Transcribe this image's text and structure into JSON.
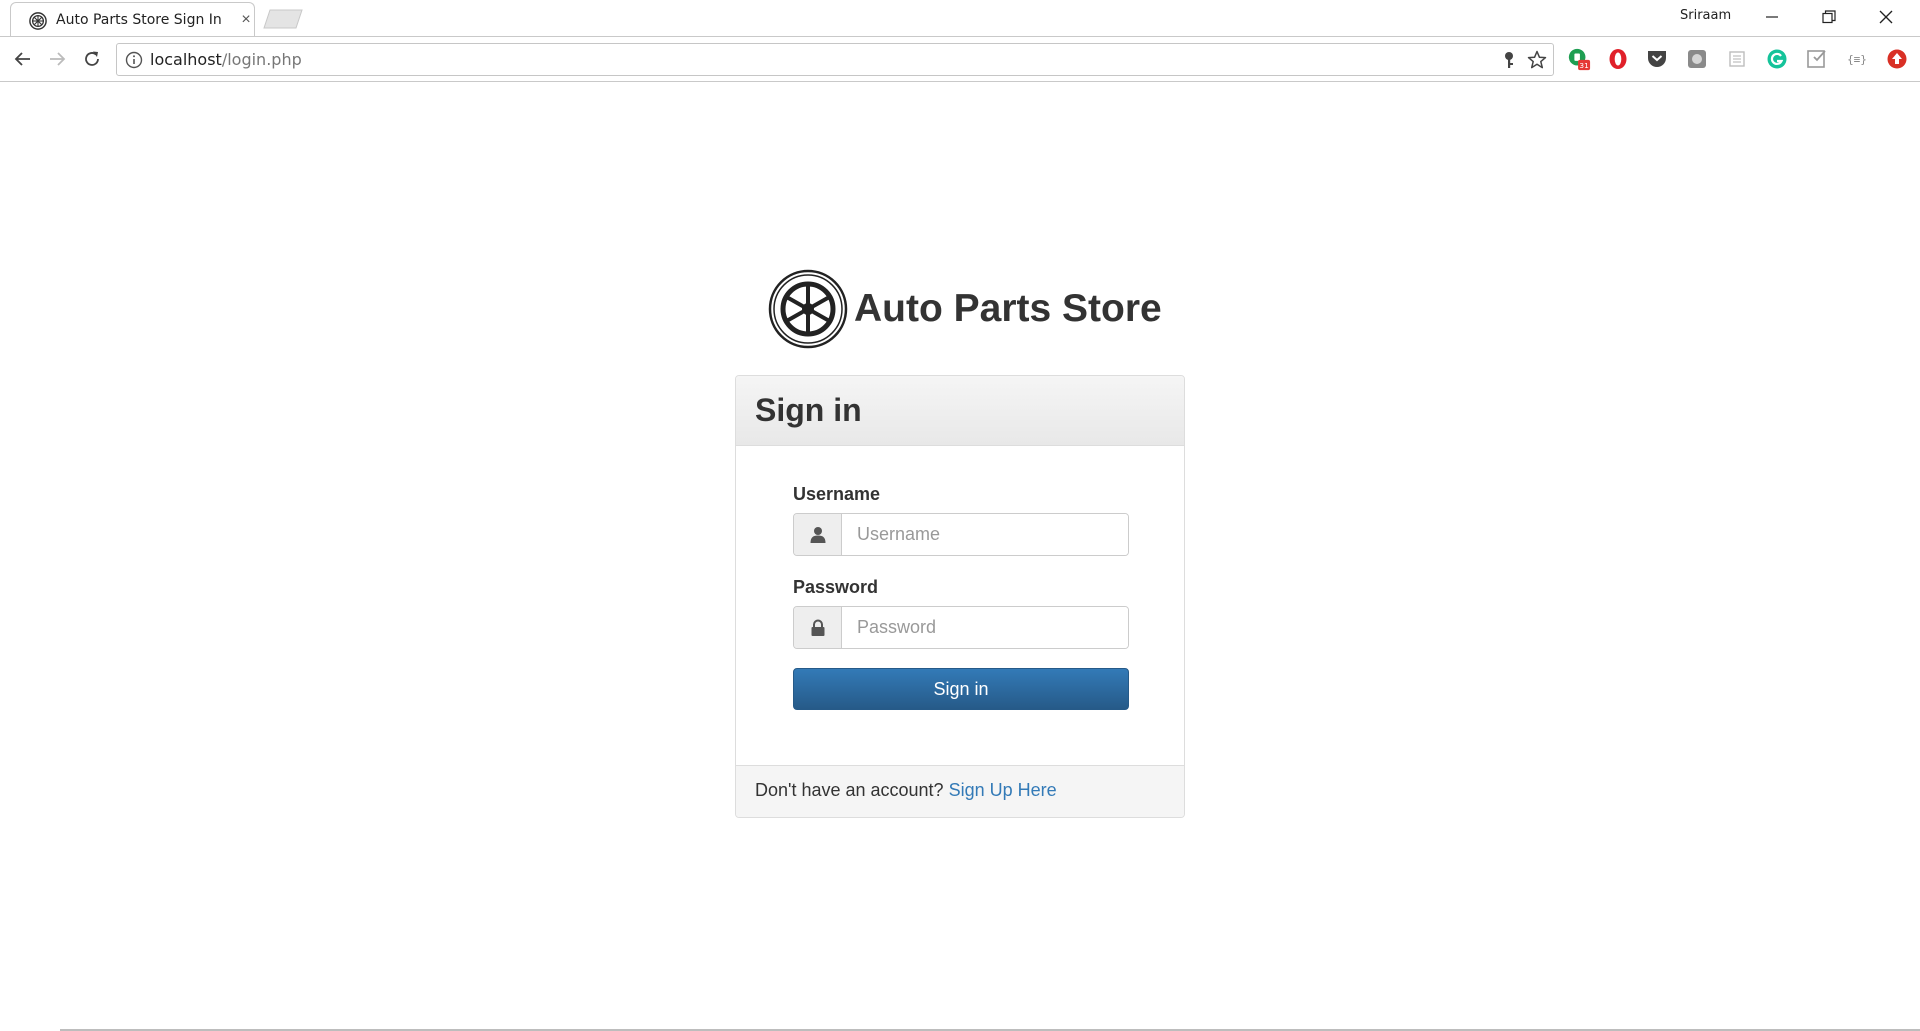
{
  "browser": {
    "tab": {
      "title": "Auto Parts Store Sign In",
      "close_icon": "×",
      "favicon_icon": "wheel-icon"
    },
    "user_name": "Sriraam",
    "address_bar": {
      "host": "localhost",
      "path": "/login.php"
    },
    "extensions": [
      {
        "name": "calendar-extension-icon",
        "badge": "31",
        "color": "#1e9e52"
      },
      {
        "name": "opera-extension-icon",
        "color": "#e0202a"
      },
      {
        "name": "pocket-extension-icon",
        "color": "#444444"
      },
      {
        "name": "gray-extension-icon",
        "color": "#8a8a8a"
      },
      {
        "name": "page-extension-icon",
        "color": "#bdbdbd"
      },
      {
        "name": "grammarly-extension-icon",
        "color": "#15c39a"
      },
      {
        "name": "tray-extension-icon",
        "color": "#999999"
      },
      {
        "name": "braces-extension-icon",
        "color": "#888888"
      },
      {
        "name": "red-circle-extension-icon",
        "color": "#d93025"
      }
    ]
  },
  "page": {
    "brand_name": "Auto Parts Store",
    "panel_title": "Sign in",
    "username": {
      "label": "Username",
      "placeholder": "Username",
      "icon": "user-icon"
    },
    "password": {
      "label": "Password",
      "placeholder": "Password",
      "icon": "lock-icon"
    },
    "submit_label": "Sign in",
    "footer": {
      "text": "Don't have an account?",
      "link": "Sign Up Here"
    }
  },
  "colors": {
    "primary": "#337ab7",
    "primary_dark": "#265a88",
    "panel_border": "#dddddd"
  }
}
